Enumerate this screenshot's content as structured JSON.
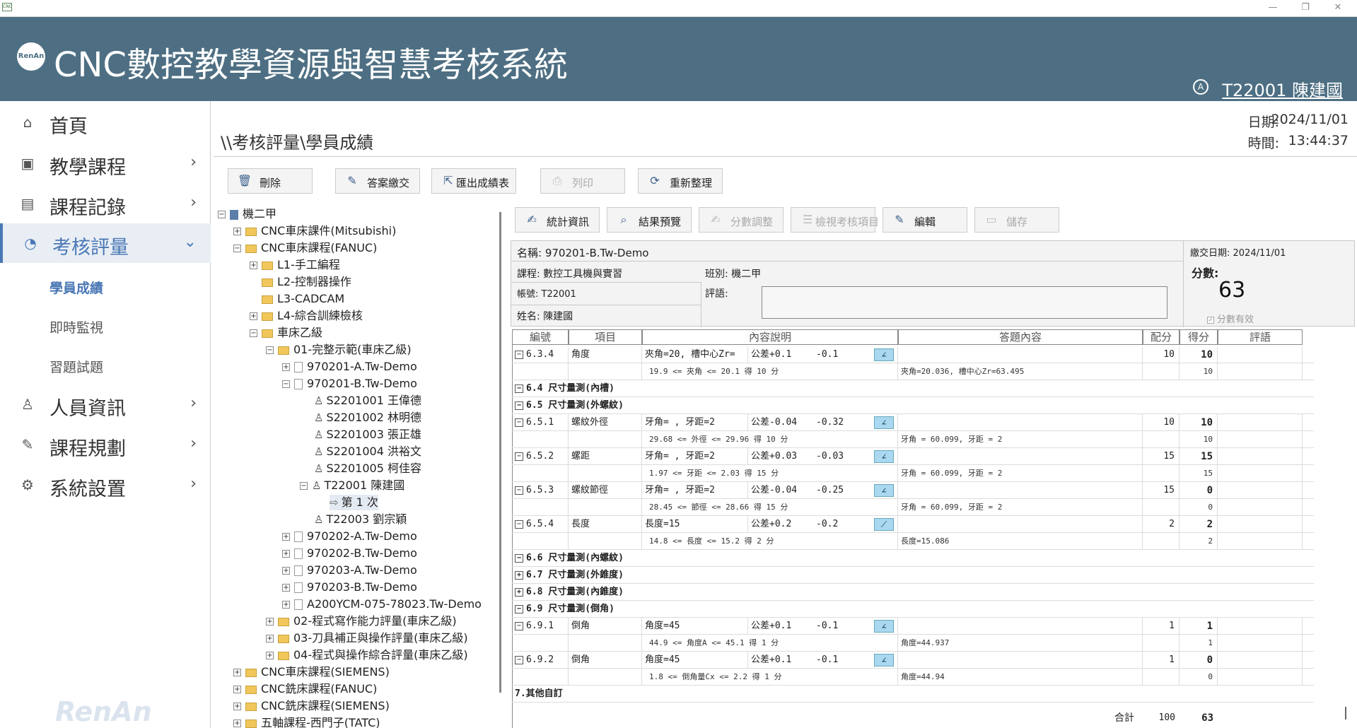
{
  "window": {
    "app_icon_text": "CNC",
    "minimize": "—",
    "maximize": "❐",
    "close": "✕"
  },
  "header": {
    "logo_text": "RenAn",
    "title": "CNC數控教學資源與智慧考核系統",
    "user_badge": "A",
    "user": "T22001 陳建國",
    "brand_color": "#4e6f83"
  },
  "sidebar": {
    "items": [
      {
        "label": "首頁",
        "icon": "home-icon"
      },
      {
        "label": "教學課程",
        "icon": "cnc-icon"
      },
      {
        "label": "課程記錄",
        "icon": "document-icon"
      },
      {
        "label": "考核評量",
        "icon": "pie-chart-icon"
      },
      {
        "label": "人員資訊",
        "icon": "person-icon"
      },
      {
        "label": "課程規劃",
        "icon": "pencil-icon"
      },
      {
        "label": "系統設置",
        "icon": "gear-icon"
      }
    ],
    "subitems": [
      "學員成績",
      "即時監視",
      "習題試題"
    ],
    "watermark": "RenAn",
    "accent_color": "#4a78b5"
  },
  "breadcrumb": "\\\\考核評量\\學員成績",
  "datetime": {
    "date_label": "日期:",
    "date": "2024/11/01",
    "time_label": "時間:",
    "time": "13:44:37"
  },
  "toolbar1": [
    "刪除",
    "答案繳交",
    "匯出成績表",
    "列印",
    "重新整理"
  ],
  "toolbar2": [
    "統計資訊",
    "結果預覽",
    "分數調整",
    "檢視考核項目",
    "編輯",
    "儲存"
  ],
  "tree": [
    {
      "text": "機二甲"
    },
    {
      "text": "CNC車床課件(Mitsubishi)"
    },
    {
      "text": "CNC車床課程(FANUC)"
    },
    {
      "text": "L1-手工編程"
    },
    {
      "text": "L2-控制器操作"
    },
    {
      "text": "L3-CADCAM"
    },
    {
      "text": "L4-綜合訓練檢核"
    },
    {
      "text": "車床乙級"
    },
    {
      "text": "01-完整示範(車床乙級)"
    },
    {
      "text": "970201-A.Tw-Demo"
    },
    {
      "text": "970201-B.Tw-Demo"
    },
    {
      "text": "S2201001 王偉德"
    },
    {
      "text": "S2201002 林明德"
    },
    {
      "text": "S2201003 張正雄"
    },
    {
      "text": "S2201004 洪裕文"
    },
    {
      "text": "S2201005 柯佳容"
    },
    {
      "text": "T22001 陳建國"
    },
    {
      "text": "第 1 次"
    },
    {
      "text": "T22003 劉宗穎"
    },
    {
      "text": "970202-A.Tw-Demo"
    },
    {
      "text": "970202-B.Tw-Demo"
    },
    {
      "text": "970203-A.Tw-Demo"
    },
    {
      "text": "970203-B.Tw-Demo"
    },
    {
      "text": "A200YCM-075-78023.Tw-Demo"
    },
    {
      "text": "02-程式寫作能力評量(車床乙級)"
    },
    {
      "text": "03-刀具補正與操作評量(車床乙級)"
    },
    {
      "text": "04-程式與操作綜合評量(車床乙級)"
    },
    {
      "text": "CNC車床課程(SIEMENS)"
    },
    {
      "text": "CNC銑床課程(FANUC)"
    },
    {
      "text": "CNC銑床課程(SIEMENS)"
    },
    {
      "text": "五軸課程-西門子(TATC)"
    }
  ],
  "info": {
    "name": "名稱: 970201-B.Tw-Demo",
    "submit": "繳交日期: 2024/11/01",
    "course": "課程: 數控工具機與實習",
    "class": "班別: 機二甲",
    "account": "帳號: T22001",
    "comment_label": "評語:",
    "student": "姓名: 陳建國",
    "score_label": "分數:",
    "score": "63",
    "score_valid": "分數有效"
  },
  "grid": {
    "headers": [
      "編號",
      "項目",
      "內容說明",
      "答題內容",
      "配分",
      "得分",
      "評語"
    ],
    "rows": [
      {
        "kind": "item",
        "no": "6.3.4",
        "item": "角度",
        "desc": "夾角=20, 槽中心Zr=",
        "tol": "公差+0.1",
        "tol2": "-0.1",
        "points": "10",
        "score": "10",
        "tool": "angle-icon"
      },
      {
        "kind": "sub",
        "desc": "19.9 <= 夾角 <= 20.1 得 10 分",
        "ans": "夾角=20.036, 槽中心Zr=63.495",
        "score": "10"
      },
      {
        "kind": "section",
        "text": "6.4 尺寸量測(內槽)",
        "sign": "−"
      },
      {
        "kind": "section",
        "text": "6.5 尺寸量測(外螺紋)",
        "sign": "−"
      },
      {
        "kind": "item",
        "no": "6.5.1",
        "item": "螺紋外徑",
        "desc": "牙角= , 牙距=2",
        "tol": "公差-0.04",
        "tol2": "-0.32",
        "points": "10",
        "score": "10",
        "tool": "angle-icon"
      },
      {
        "kind": "sub",
        "desc": "29.68 <= 外徑 <= 29.96 得 10 分",
        "ans": "牙角 = 60.099, 牙距 = 2",
        "score": "10"
      },
      {
        "kind": "item",
        "no": "6.5.2",
        "item": "螺距",
        "desc": "牙角= , 牙距=2",
        "tol": "公差+0.03",
        "tol2": "-0.03",
        "points": "15",
        "score": "15",
        "tool": "angle-icon"
      },
      {
        "kind": "sub",
        "desc": "1.97 <= 牙距 <= 2.03 得 15 分",
        "ans": "牙角 = 60.099, 牙距 = 2",
        "score": "15"
      },
      {
        "kind": "item",
        "no": "6.5.3",
        "item": "螺紋節徑",
        "desc": "牙角= , 牙距=2",
        "tol": "公差-0.04",
        "tol2": "-0.25",
        "points": "15",
        "score": "0",
        "tool": "angle-icon"
      },
      {
        "kind": "sub",
        "desc": "28.45 <= 節徑 <= 28.66 得 15 分",
        "ans": "牙角 = 60.099, 牙距 = 2",
        "score": "0"
      },
      {
        "kind": "item",
        "no": "6.5.4",
        "item": "長度",
        "desc": "長度=15",
        "tol": "公差+0.2",
        "tol2": "-0.2",
        "points": "2",
        "score": "2",
        "tool": "line-icon"
      },
      {
        "kind": "sub",
        "desc": "14.8 <= 長度 <= 15.2 得 2 分",
        "ans": "長度=15.086",
        "score": "2"
      },
      {
        "kind": "section",
        "text": "6.6 尺寸量測(內螺紋)",
        "sign": "−"
      },
      {
        "kind": "section",
        "text": "6.7 尺寸量測(外錐度)",
        "sign": "+"
      },
      {
        "kind": "section",
        "text": "6.8 尺寸量測(內錐度)",
        "sign": "+"
      },
      {
        "kind": "section",
        "text": "6.9 尺寸量測(倒角)",
        "sign": "−"
      },
      {
        "kind": "item",
        "no": "6.9.1",
        "item": "倒角",
        "desc": "角度=45",
        "tol": "公差+0.1",
        "tol2": "-0.1",
        "points": "1",
        "score": "1",
        "tool": "angle-icon"
      },
      {
        "kind": "sub",
        "desc": "44.9 <= 角度A <= 45.1 得 1 分",
        "ans": "角度=44.937",
        "score": "1"
      },
      {
        "kind": "item",
        "no": "6.9.2",
        "item": "倒角",
        "desc": "角度=45",
        "tol": "公差+0.1",
        "tol2": "-0.1",
        "points": "1",
        "score": "0",
        "tool": "angle-icon"
      },
      {
        "kind": "sub",
        "desc": "1.8 <= 倒角量Cx <= 2.2 得 1 分",
        "ans": "角度=44.94",
        "score": "0"
      },
      {
        "kind": "section",
        "text": "7.其他自訂",
        "sign": ""
      }
    ],
    "total_label": "合計",
    "total_points": "100",
    "total_score": "63"
  }
}
